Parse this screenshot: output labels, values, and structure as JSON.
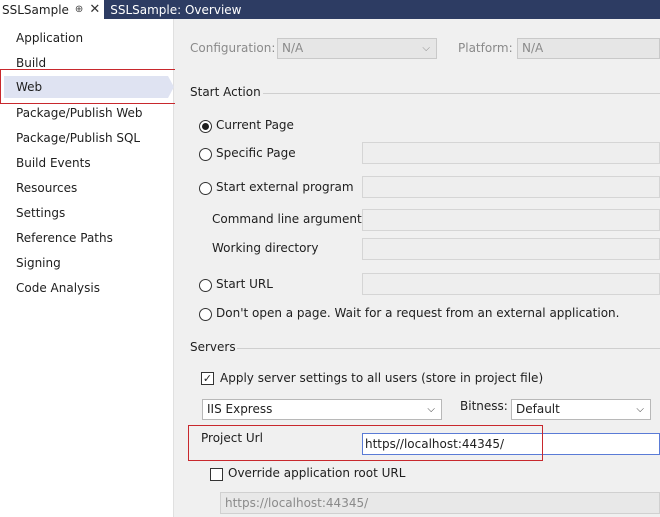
{
  "tabs": {
    "active_label": "SSLSample",
    "pin_glyph": "⊕",
    "close_glyph": "✕",
    "inactive_label": "SSLSample: Overview"
  },
  "nav": {
    "items": [
      "Application",
      "Build",
      "Web",
      "Package/Publish Web",
      "Package/Publish SQL",
      "Build Events",
      "Resources",
      "Settings",
      "Reference Paths",
      "Signing",
      "Code Analysis"
    ],
    "selected": "Web"
  },
  "config": {
    "configuration_label": "Configuration:",
    "configuration_value": "N/A",
    "platform_label": "Platform:",
    "platform_value": "N/A"
  },
  "start_action": {
    "heading": "Start Action",
    "current_page": "Current Page",
    "specific_page": "Specific Page",
    "start_external": "Start external program",
    "cmd_args": "Command line arguments",
    "working_dir": "Working directory",
    "start_url": "Start URL",
    "dont_open": "Don't open a page.  Wait for a request from an external application.",
    "selected": "Current Page"
  },
  "servers": {
    "heading": "Servers",
    "apply_all_users": "Apply server settings to all users (store in project file)",
    "apply_checked": true,
    "server_value": "IIS Express",
    "bitness_label": "Bitness:",
    "bitness_value": "Default",
    "project_url_label": "Project Url",
    "project_url_value": "https//localhost:44345/",
    "override_label": "Override application root URL",
    "override_checked": false,
    "override_value": "https://localhost:44345/"
  },
  "colors": {
    "tab_strip": "#2d3c63",
    "nav_selected": "#dfe3f2",
    "highlight_red": "#c8282d",
    "input_focus": "#5a7bd6"
  }
}
